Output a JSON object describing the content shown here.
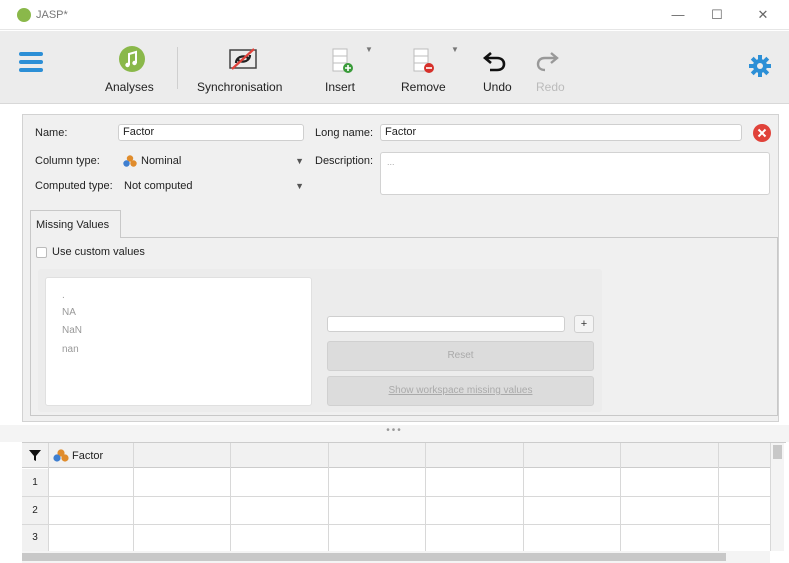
{
  "window": {
    "title": "JASP*",
    "minimize_glyph": "—",
    "maximize_glyph": "☐",
    "close_glyph": "✕"
  },
  "toolbar": {
    "menu_icon": "hamburger-icon",
    "analyses_label": "Analyses",
    "synchronisation_label": "Synchronisation",
    "insert_label": "Insert",
    "remove_label": "Remove",
    "undo_label": "Undo",
    "redo_label": "Redo",
    "settings_icon": "gear-icon",
    "accent_blue": "#2c8fd6",
    "accent_green": "#8ab84a"
  },
  "properties": {
    "name_label": "Name:",
    "name_value": "Factor",
    "long_name_label": "Long name:",
    "long_name_value": "Factor",
    "column_type_label": "Column type:",
    "column_type_value": "Nominal",
    "computed_type_label": "Computed type:",
    "computed_type_value": "Not computed",
    "description_label": "Description:",
    "description_placeholder": "...",
    "close_color": "#e0423a"
  },
  "missing_values": {
    "tab_label": "Missing Values",
    "use_custom_label": "Use custom values",
    "items": [
      ".",
      "NA",
      "NaN",
      "nan"
    ],
    "add_label": "+",
    "reset_label": "Reset",
    "show_workspace_label": "Show workspace missing values"
  },
  "splitter": {
    "dots": "•••"
  },
  "grid": {
    "filter_icon": "filter-icon",
    "column_header": "Factor",
    "row_numbers": [
      "1",
      "2",
      "3"
    ]
  }
}
